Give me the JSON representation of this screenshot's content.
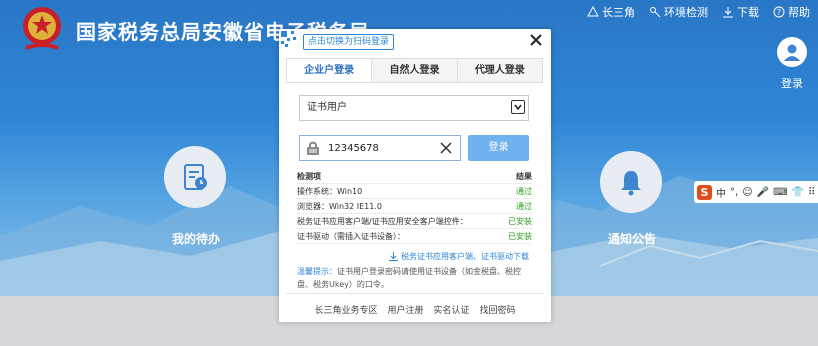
{
  "site": {
    "title": "国家税务总局安徽省电子税务局",
    "emblem_text": "中国税务"
  },
  "topnav": [
    {
      "label": "长三角",
      "icon": "region-icon"
    },
    {
      "label": "环境检测",
      "icon": "wrench-icon"
    },
    {
      "label": "下载",
      "icon": "download-icon"
    },
    {
      "label": "帮助",
      "icon": "help-icon"
    }
  ],
  "user": {
    "login_label": "登录"
  },
  "tiles": {
    "todo": "我的待办",
    "notice": "通知公告"
  },
  "ime": {
    "char": "中"
  },
  "modal": {
    "switch_label": "点击切换为扫码登录",
    "tabs": [
      "企业户登录",
      "自然人登录",
      "代理人登录"
    ],
    "active_tab": 0,
    "cert_select": "证书用户",
    "password_value": "12345678",
    "login_button": "登录",
    "check": {
      "header_item": "检测项",
      "header_result": "结果",
      "rows": [
        {
          "item": "操作系统：Win10",
          "result": "通过"
        },
        {
          "item": "浏览器：Win32 IE11.0",
          "result": "通过"
        },
        {
          "item": "税务证书应用客户端/证书应用安全客户端控件：",
          "result": "已安装"
        },
        {
          "item": "证书驱动（需插入证书设备）：",
          "result": "已安装"
        }
      ]
    },
    "download_link": "税务证书应用客户端、证书驱动下载",
    "tip_key": "温馨提示：",
    "tip_text": "证书用户登录密码请使用证书设备（如金税盘、税控盘、税务Ukey）的口令。",
    "footer": [
      "长三角业务专区",
      "用户注册",
      "实名认证",
      "找回密码"
    ]
  },
  "colors": {
    "brand_blue": "#2f86d6",
    "pass_green": "#2aa01f",
    "button_blue": "#6fb2ef"
  }
}
